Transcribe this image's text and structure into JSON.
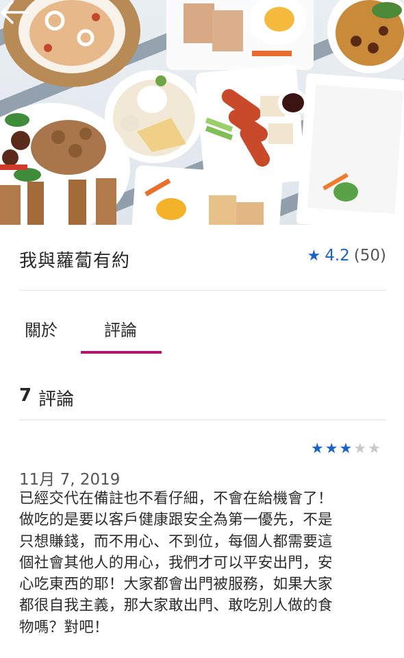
{
  "hero": {
    "image_alt": ""
  },
  "navigation": {
    "back_icon": "arrow-left-icon"
  },
  "store": {
    "name": "我與蘿蔔有約"
  },
  "rating": {
    "star_icon": "star-icon",
    "score": "4.2",
    "count": "(50)",
    "color": "#1a63c9"
  },
  "tabs": [
    {
      "label": "關於",
      "active": false
    },
    {
      "label": "評論",
      "active": true
    }
  ],
  "tab_indicator_color": "#b2166f",
  "reviews_summary": {
    "count": "7",
    "label": "評論"
  },
  "reviews": [
    {
      "stars": 3,
      "max_stars": 5,
      "date": "11月 7, 2019",
      "text_lines": [
        "已經交代在備註也不看仔細，不會在給機會了！",
        "做吃的是要以客戶健康跟安全為第一優先，不是",
        "只想賺錢，而不用心、不到位，每個人都需要這",
        "個社會其他人的用心，我們才可以平安出門，安",
        "心吃東西的耶！大家都會出門被服務，如果大家",
        "都很自我主義，那大家敢出門、敢吃別人做的食",
        "物嗎？對吧！"
      ]
    }
  ]
}
